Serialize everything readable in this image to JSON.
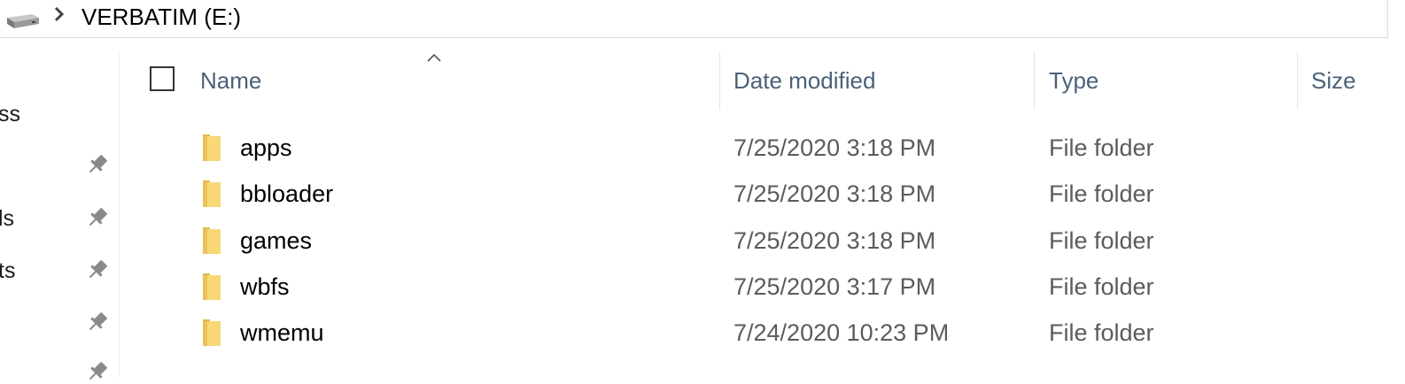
{
  "window": {
    "title": "VERBATIM (E:)"
  },
  "address_bar": {
    "drive_icon": "removable-drive-icon",
    "chevron_icon": "chevron-right-icon",
    "path": "VERBATIM (E:)"
  },
  "nav_pane": {
    "items": [
      {
        "label": "ss",
        "pinned": false
      },
      {
        "label": "",
        "pinned": true
      },
      {
        "label": "ls",
        "pinned": true
      },
      {
        "label": "ts",
        "pinned": true
      },
      {
        "label": "",
        "pinned": true
      },
      {
        "label": "",
        "pinned": true
      }
    ],
    "pin_icon": "pin-icon"
  },
  "file_list": {
    "columns": [
      {
        "label": "Name",
        "sorted": "ascending"
      },
      {
        "label": "Date modified"
      },
      {
        "label": "Type"
      },
      {
        "label": "Size"
      }
    ],
    "rows": [
      {
        "name": "apps",
        "date": "7/25/2020 3:18 PM",
        "type": "File folder",
        "icon": "folder-icon"
      },
      {
        "name": "bbloader",
        "date": "7/25/2020 3:18 PM",
        "type": "File folder",
        "icon": "folder-icon"
      },
      {
        "name": "games",
        "date": "7/25/2020 3:18 PM",
        "type": "File folder",
        "icon": "folder-icon"
      },
      {
        "name": "wbfs",
        "date": "7/25/2020 3:17 PM",
        "type": "File folder",
        "icon": "folder-icon"
      },
      {
        "name": "wmemu",
        "date": "7/24/2020 10:23 PM",
        "type": "File folder",
        "icon": "folder-icon"
      }
    ]
  },
  "colors": {
    "header_text": "#4c607a",
    "folder_yellow": "#f8d775",
    "detail_text": "#5b5b5b"
  }
}
